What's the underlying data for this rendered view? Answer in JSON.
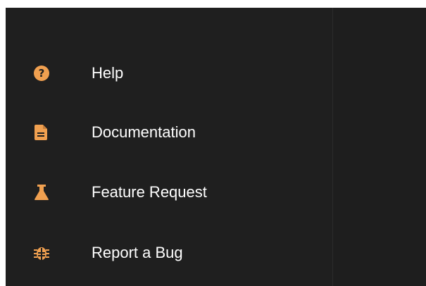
{
  "accent_color": "#f0a050",
  "menu": {
    "items": [
      {
        "label": "Help",
        "icon": "help-circle-icon"
      },
      {
        "label": "Documentation",
        "icon": "document-icon"
      },
      {
        "label": "Feature Request",
        "icon": "flask-icon"
      },
      {
        "label": "Report a Bug",
        "icon": "bug-icon"
      }
    ]
  }
}
